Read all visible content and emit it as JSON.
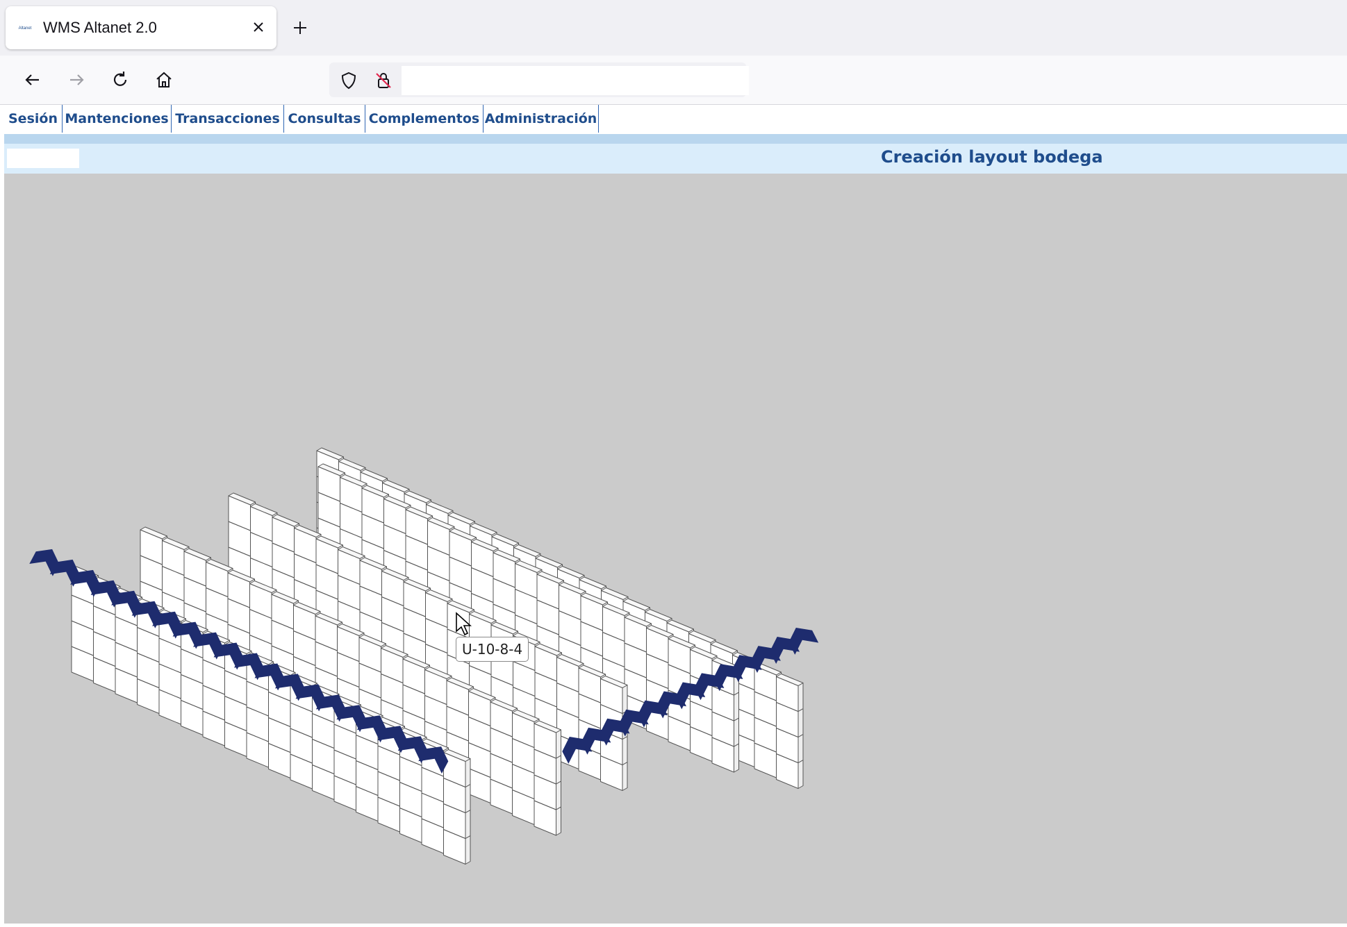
{
  "browser": {
    "tab_title": "WMS Altanet 2.0",
    "favicon_text": "Altanet",
    "url": ""
  },
  "menu": {
    "items": [
      "Sesión",
      "Mantenciones",
      "Transacciones",
      "Consultas",
      "Complementos",
      "Administración"
    ]
  },
  "page": {
    "title": "Creación layout bodega"
  },
  "warehouse_layout": {
    "tooltip": "U-10-8-4",
    "rack_levels": 4,
    "rack_rows": [
      {
        "positions": 18
      },
      {
        "positions": 19
      },
      {
        "positions": 18
      },
      {
        "positions": 19
      },
      {
        "positions": 22
      }
    ],
    "arrow_groups": [
      {
        "name": "left-arrow-track",
        "direction": "diagonal-down-right",
        "count": 20
      },
      {
        "name": "right-arrow-track",
        "direction": "diagonal-up-right",
        "count": 13
      }
    ],
    "colors": {
      "background": "#cbcbcb",
      "box_fill": "#ffffff",
      "box_stroke": "#555555",
      "arrow": "#1e2c6e"
    }
  },
  "theme": {
    "menu_text": "#1f4d8c",
    "title_bar_bg": "#daedfb"
  }
}
